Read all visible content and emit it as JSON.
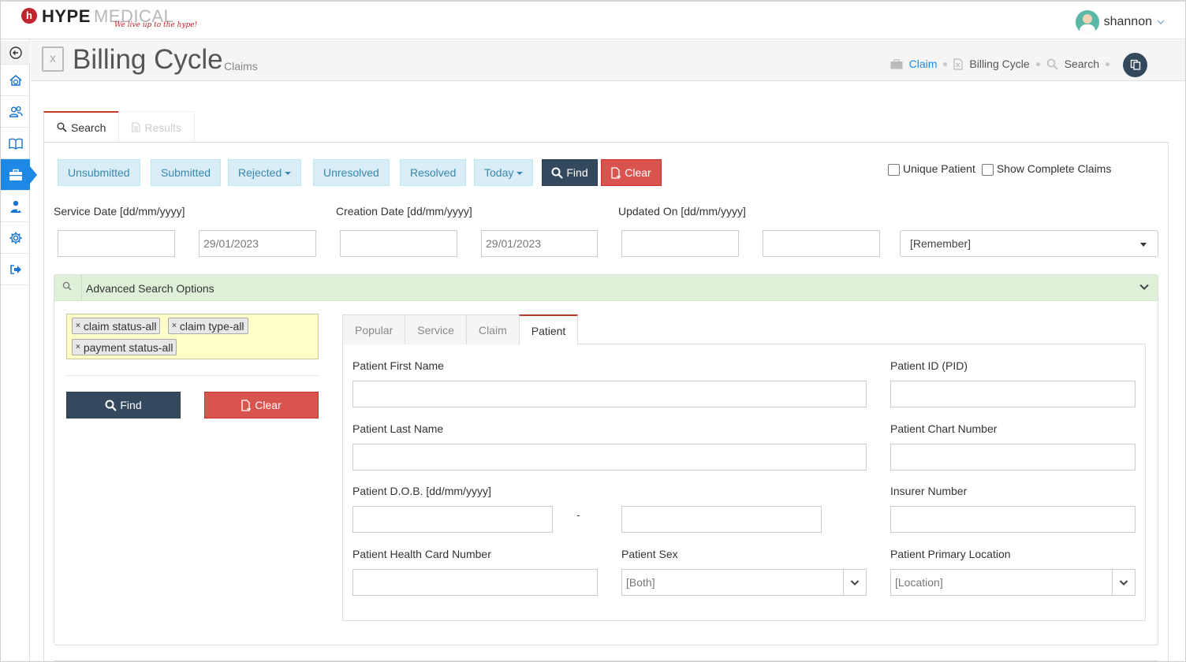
{
  "header": {
    "logo_mark": "h",
    "logo_word1": "HYPE",
    "logo_word2": "MEDICAL",
    "logo_tagline": "We live up to the hype!",
    "username": "shannon"
  },
  "page": {
    "title": "Billing Cycle",
    "subtitle": "Claims"
  },
  "breadcrumb": {
    "items": [
      "Claim",
      "Billing Cycle",
      "Search"
    ]
  },
  "tabs": {
    "search": "Search",
    "results": "Results"
  },
  "filters": {
    "unsubmitted": "Unsubmitted",
    "submitted": "Submitted",
    "rejected": "Rejected",
    "unresolved": "Unresolved",
    "resolved": "Resolved",
    "today": "Today",
    "find": "Find",
    "clear": "Clear",
    "unique_patient": "Unique Patient",
    "show_complete": "Show Complete Claims"
  },
  "dates": {
    "service_label": "Service Date [dd/mm/yyyy]",
    "creation_label": "Creation Date [dd/mm/yyyy]",
    "updated_label": "Updated On [dd/mm/yyyy]",
    "service_from": "",
    "service_to": "29/01/2023",
    "creation_from": "",
    "creation_to": "29/01/2023",
    "updated_from": "",
    "updated_to": "",
    "remember": "[Remember]"
  },
  "advanced": {
    "title": "Advanced Search Options",
    "tags": [
      "claim status-all",
      "claim type-all",
      "payment status-all"
    ],
    "find": "Find",
    "clear": "Clear",
    "tabs": [
      "Popular",
      "Service",
      "Claim",
      "Patient"
    ],
    "fields": {
      "first_name": "Patient First Name",
      "pid": "Patient ID (PID)",
      "last_name": "Patient Last Name",
      "chart_number": "Patient Chart Number",
      "dob": "Patient D.O.B. [dd/mm/yyyy]",
      "dob_sep": "-",
      "insurer": "Insurer Number",
      "health_card": "Patient Health Card Number",
      "sex": "Patient Sex",
      "sex_value": "[Both]",
      "location": "Patient Primary Location",
      "location_value": "[Location]"
    }
  },
  "colors": {
    "accent": "#1e88e5",
    "dark_button": "#34495e",
    "danger": "#d9534f",
    "info_bg": "#d9edf7",
    "success_bg": "#dff0d8",
    "tag_box": "#ffffc8"
  }
}
